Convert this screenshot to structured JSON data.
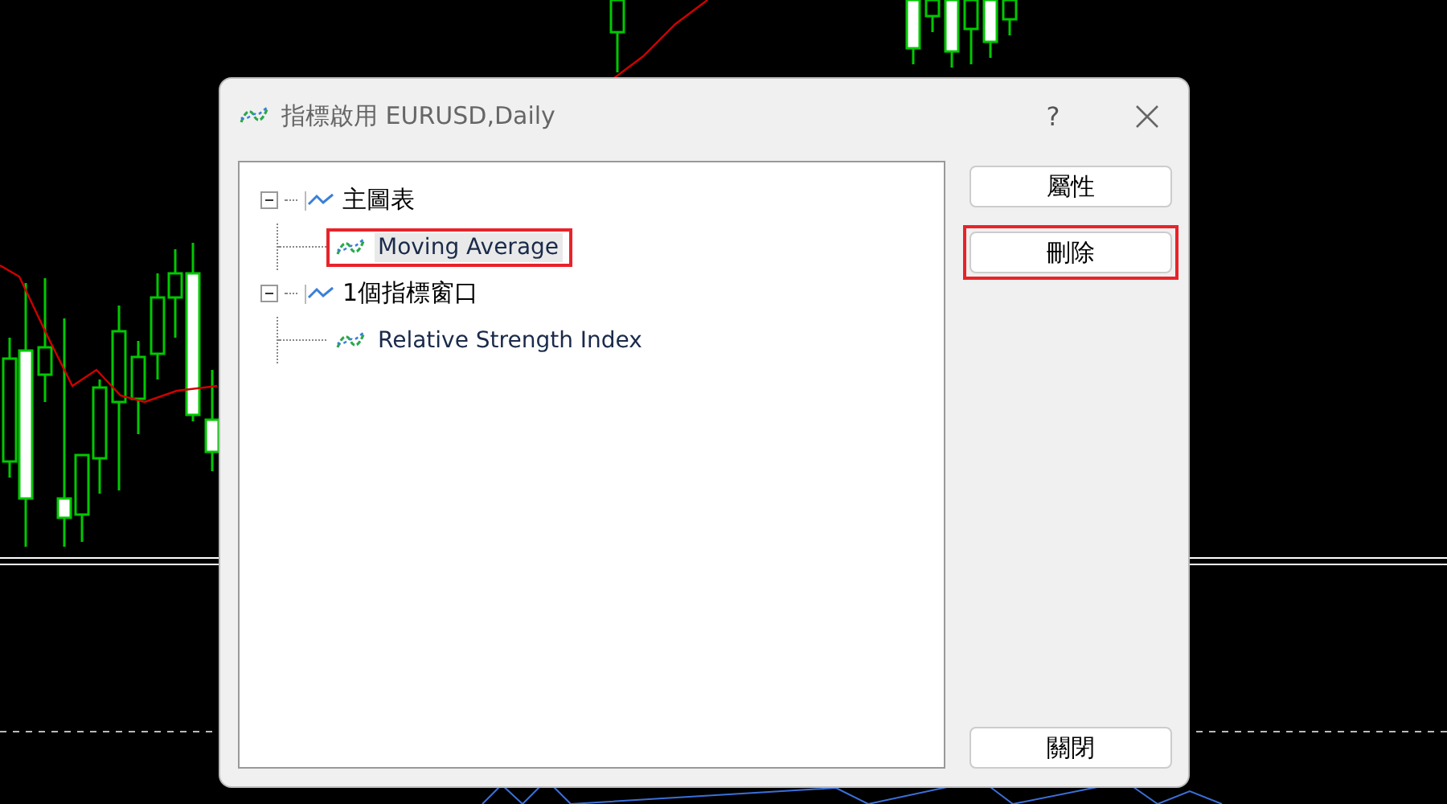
{
  "dialog": {
    "title": "指標啟用 EURUSD,Daily",
    "help": "?"
  },
  "tree": [
    {
      "label": "主圖表",
      "expanded": true,
      "children": [
        {
          "label": "Moving Average",
          "selected": true,
          "highlighted": true
        }
      ]
    },
    {
      "label": "1個指標窗口",
      "expanded": true,
      "children": [
        {
          "label": "Relative Strength Index",
          "selected": false,
          "highlighted": false
        }
      ]
    }
  ],
  "buttons": [
    {
      "label": "屬性",
      "highlighted": false
    },
    {
      "label": "刪除",
      "highlighted": true
    },
    {
      "label": "關閉",
      "highlighted": false
    }
  ]
}
